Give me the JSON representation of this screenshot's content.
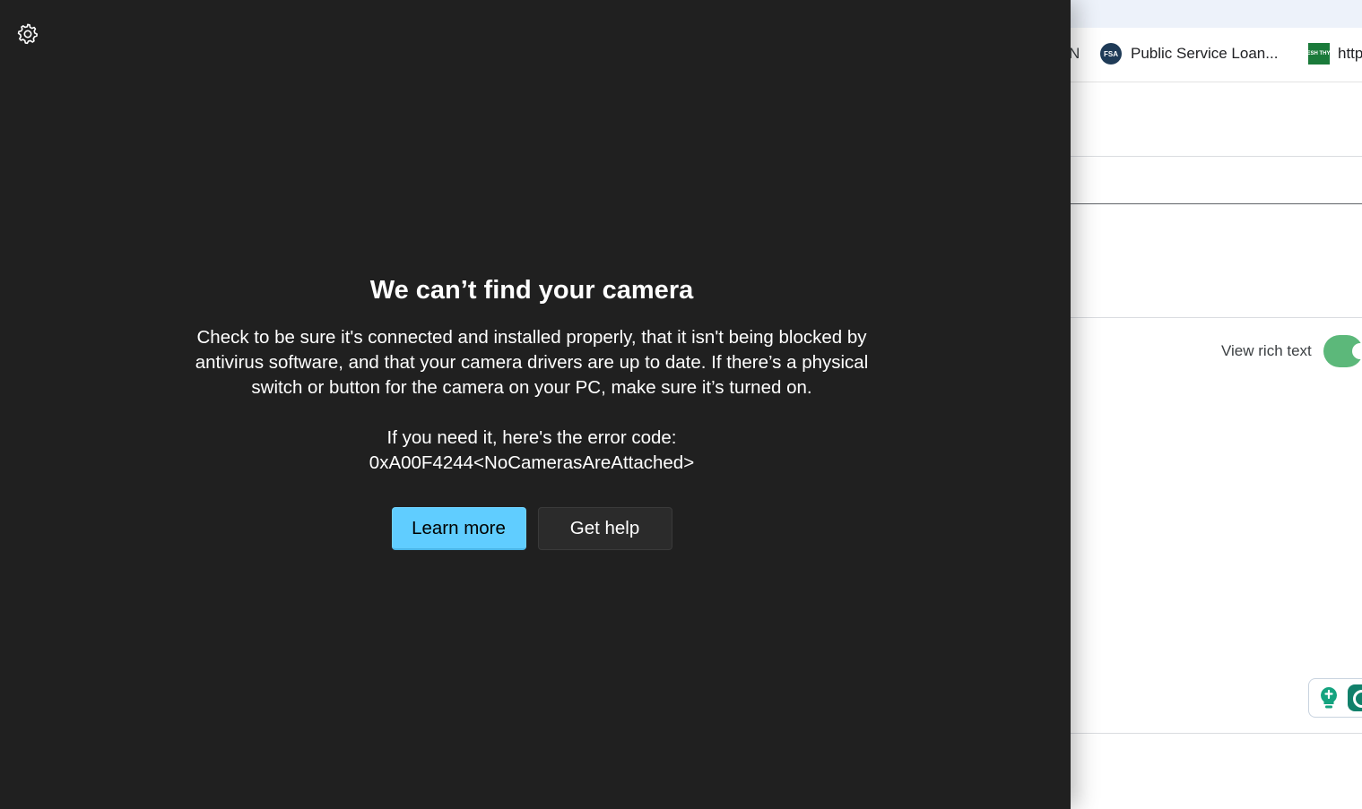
{
  "browser": {
    "bookmarks": [
      {
        "partial_label": "N"
      },
      {
        "label": "Public Service Loan...",
        "favicon": "FSA"
      },
      {
        "label": "http",
        "favicon": "FRESH THYME"
      }
    ],
    "rich_text_label": "View rich text",
    "rich_text_toggle_on": true,
    "toggle_color": "#5cb87a"
  },
  "camera": {
    "settings_icon": "gear-icon",
    "title": "We can’t find your camera",
    "body": "Check to be sure it's connected and installed properly, that it isn't being blocked by antivirus software, and that your camera drivers are up to date. If there’s a physical switch or button for the camera on your PC, make sure it’s turned on.",
    "error_code_label": "If you need it, here's the error code:",
    "error_code": "0xA00F4244<NoCamerasAreAttached>",
    "learn_more_label": "Learn more",
    "get_help_label": "Get help",
    "accent_color": "#60cdff",
    "background_color": "#202020"
  }
}
